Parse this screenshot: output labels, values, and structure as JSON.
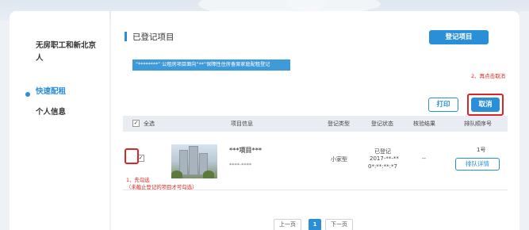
{
  "sidebar": {
    "items": [
      {
        "label": "无房职工和新北京人"
      },
      {
        "label": "快速配租",
        "active": true
      },
      {
        "label": "个人信息"
      }
    ]
  },
  "main": {
    "title": "已登记项目",
    "register_button": "登记项目",
    "banner_text": "“********” 公租房项目面向“**”保障性住房备案家庭配租登记",
    "step2_hint": "2、再点击取消",
    "print_button": "打印",
    "cancel_button": "取消"
  },
  "table": {
    "headers": {
      "select_all": "全选",
      "project_info": "项目信息",
      "register_type": "登记类型",
      "register_status": "登记状态",
      "verify_result": "核验结果",
      "queue_no": "排队顺序号"
    },
    "rows": [
      {
        "checked": true,
        "project_name": "***项目***",
        "project_sub": "****·****",
        "register_type": "小家型",
        "status_line1": "已登记",
        "status_line2": "2017-**-**",
        "status_line3": "0*:**:**:*7",
        "verify_result": "--",
        "queue_no": "1号",
        "queue_button": "排队详情"
      }
    ],
    "step1_hint_line1": "1、先勾选",
    "step1_hint_line2": "（未截止登记的项目才可勾选）"
  },
  "pagination": {
    "prev": "上一页",
    "current": "1",
    "next": "下一页"
  },
  "colors": {
    "accent": "#2b8fd7",
    "highlight_red": "#d9262c"
  },
  "icons": {
    "checkbox_checked": "check-icon"
  }
}
